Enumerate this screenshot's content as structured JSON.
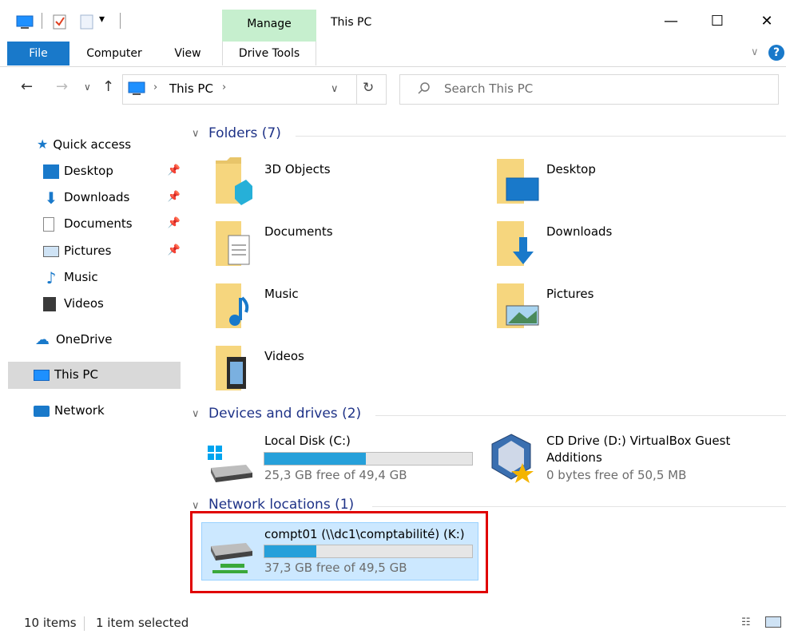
{
  "window": {
    "title": "This PC"
  },
  "ribbon": {
    "context_group": "Manage",
    "tabs": [
      "File",
      "Computer",
      "View",
      "Drive Tools"
    ]
  },
  "address": {
    "crumb": "This PC",
    "search_placeholder": "Search This PC"
  },
  "nav": {
    "quick_access": "Quick access",
    "items": [
      {
        "label": "Desktop",
        "pinned": true
      },
      {
        "label": "Downloads",
        "pinned": true
      },
      {
        "label": "Documents",
        "pinned": true
      },
      {
        "label": "Pictures",
        "pinned": true
      },
      {
        "label": "Music",
        "pinned": false
      },
      {
        "label": "Videos",
        "pinned": false
      }
    ],
    "onedrive": "OneDrive",
    "this_pc": "This PC",
    "network": "Network"
  },
  "sections": {
    "folders": "Folders (7)",
    "devices": "Devices and drives (2)",
    "network": "Network locations (1)"
  },
  "folders": [
    "3D Objects",
    "Desktop",
    "Documents",
    "Downloads",
    "Music",
    "Pictures",
    "Videos"
  ],
  "drives": [
    {
      "name": "Local Disk (C:)",
      "free": "25,3 GB free of 49,4 GB",
      "used_fraction": 0.49
    },
    {
      "name": "CD Drive (D:) VirtualBox Guest Additions",
      "free": "0 bytes free of 50,5 MB"
    }
  ],
  "network_drive": {
    "name": "compt01 (\\\\dc1\\comptabilité) (K:)",
    "free": "37,3 GB free of 49,5 GB",
    "used_fraction": 0.25
  },
  "status": {
    "items": "10 items",
    "selected": "1 item selected"
  },
  "colors": {
    "accent": "#1979ca",
    "header": "#1e3287",
    "bar": "#26a0da",
    "highlight": "#e00000",
    "manage": "#c6efce"
  }
}
